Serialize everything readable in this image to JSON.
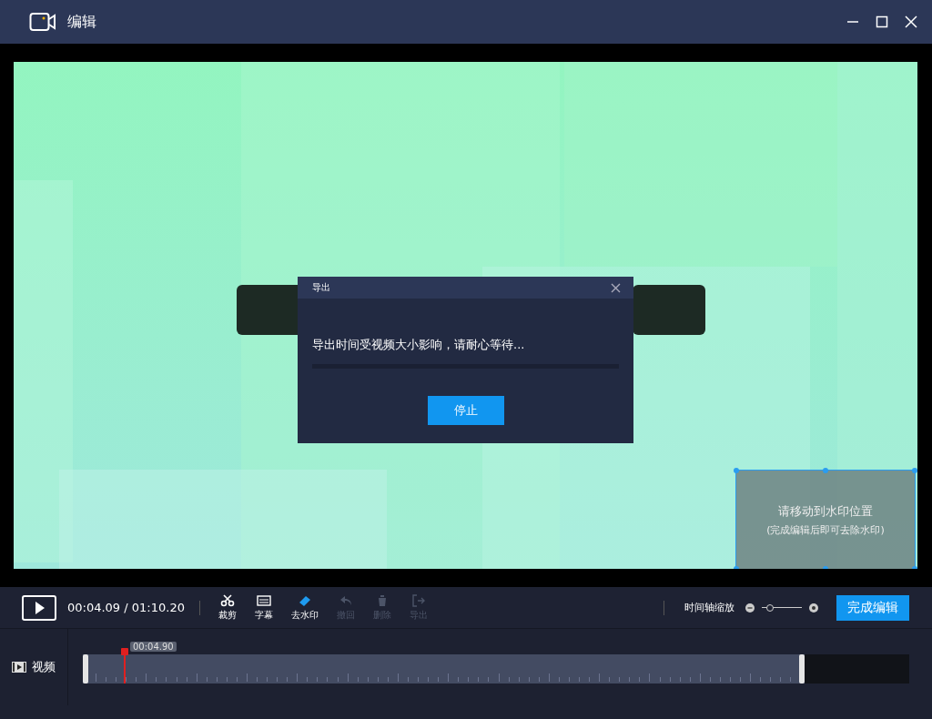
{
  "window": {
    "title": "编辑"
  },
  "dialog": {
    "title": "导出",
    "message": "导出时间受视频大小影响，请耐心等待...",
    "button": "停止"
  },
  "watermark_box": {
    "line_1": "请移动到水印位置",
    "line_2": "(完成编辑后即可去除水印)"
  },
  "toolbar": {
    "time": "00:04.09 / 01:10.20",
    "tools": [
      {
        "kind": "cut",
        "label": "裁剪",
        "disabled": false
      },
      {
        "kind": "subtitle",
        "label": "字幕",
        "disabled": false
      },
      {
        "kind": "erase",
        "label": "去水印",
        "disabled": false
      },
      {
        "kind": "undo",
        "label": "撤回",
        "disabled": true
      },
      {
        "kind": "delete",
        "label": "删除",
        "disabled": true
      },
      {
        "kind": "export",
        "label": "导出",
        "disabled": true
      }
    ],
    "zoom_label": "时间轴缩放",
    "zoom": {
      "level": 0.2
    },
    "done_button": "完成编辑"
  },
  "timeline": {
    "track_label": "视频",
    "playhead": {
      "time": "00:04.90"
    }
  }
}
